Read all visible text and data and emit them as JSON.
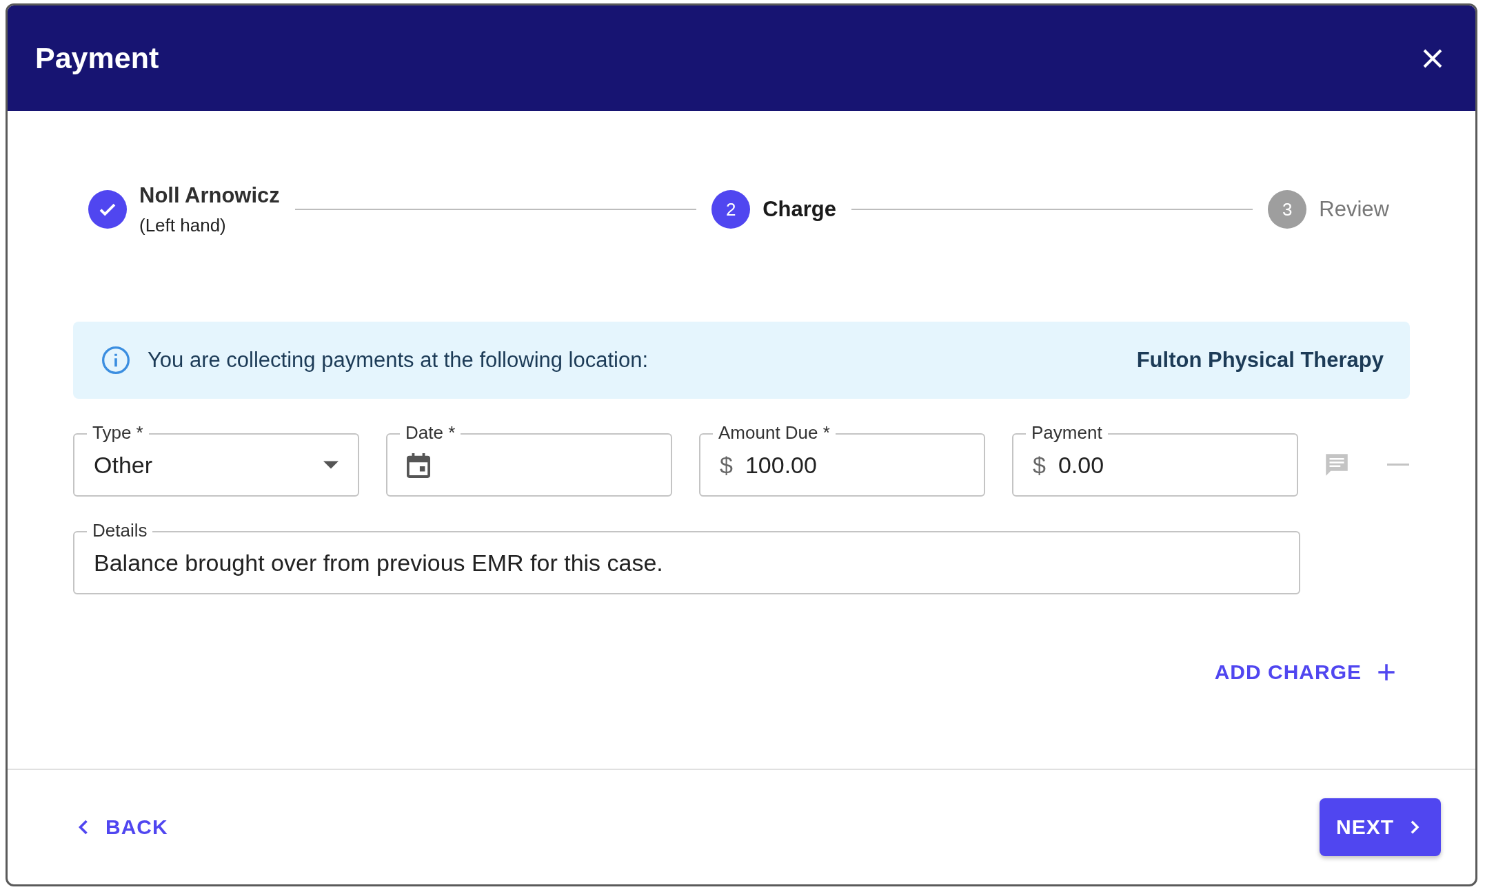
{
  "dialog": {
    "title": "Payment"
  },
  "steps": [
    {
      "label": "Noll Arnowicz",
      "sublabel": "(Left hand)",
      "completed": true,
      "selected": false
    },
    {
      "label": "Charge",
      "number": "2",
      "completed": false,
      "selected": true
    },
    {
      "label": "Review",
      "number": "3",
      "completed": false,
      "selected": false
    }
  ],
  "info": {
    "message": "You are collecting payments at the following location:",
    "location": "Fulton Physical Therapy"
  },
  "fields": [
    {
      "kind": "select",
      "label": "Type *",
      "value": "Other"
    },
    {
      "kind": "date",
      "label": "Date *"
    },
    {
      "kind": "currency",
      "label": "Amount Due *",
      "prefix": "$",
      "value": "100.00"
    },
    {
      "kind": "currency",
      "label": "Payment",
      "prefix": "$",
      "value": "0.00"
    }
  ],
  "details": {
    "label": "Details",
    "value": "Balance brought over from previous EMR for this case."
  },
  "add_charge": "ADD CHARGE",
  "footer": {
    "back": "BACK",
    "next": "NEXT"
  }
}
